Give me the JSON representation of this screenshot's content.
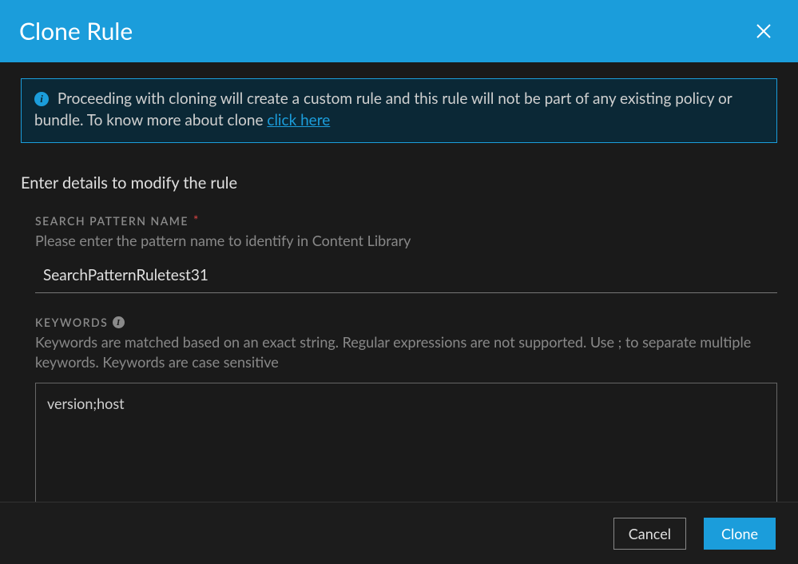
{
  "header": {
    "title": "Clone Rule"
  },
  "banner": {
    "text": "Proceeding with cloning will create a custom rule and this rule will not be part of any existing policy or bundle. To know more about clone ",
    "link_label": "click here"
  },
  "section_prompt": "Enter details to modify the rule",
  "fields": {
    "search_pattern": {
      "label": "SEARCH PATTERN NAME",
      "help": "Please enter the pattern name to identify in Content Library",
      "value": "SearchPatternRuletest31"
    },
    "keywords": {
      "label": "KEYWORDS",
      "help": "Keywords are matched based on an exact string. Regular expressions are not supported. Use ; to separate multiple keywords. Keywords are case sensitive",
      "value": "version;host"
    }
  },
  "footer": {
    "cancel_label": "Cancel",
    "clone_label": "Clone"
  }
}
